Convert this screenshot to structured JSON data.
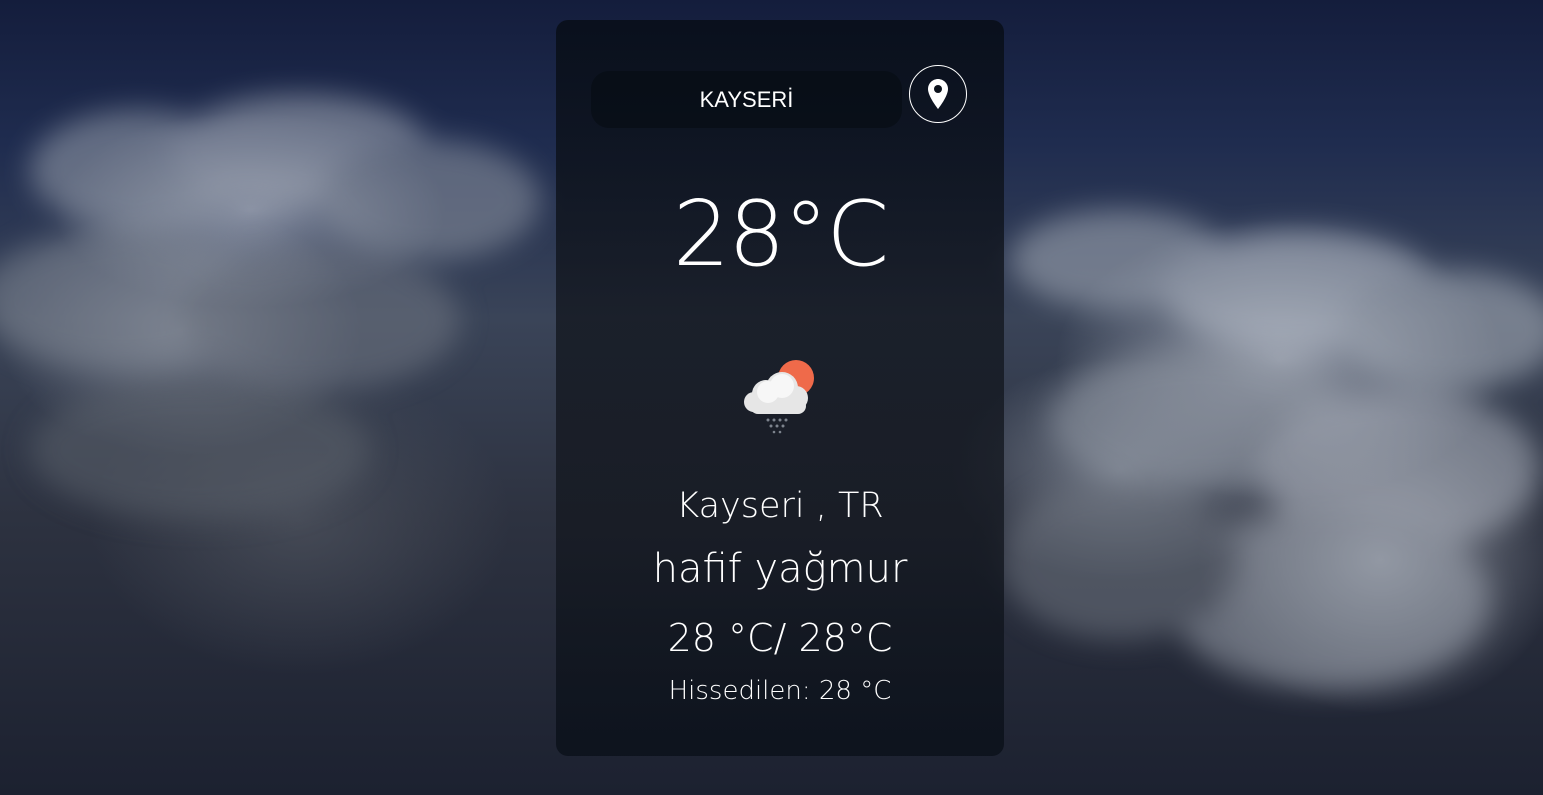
{
  "search": {
    "value": "KAYSERİ",
    "placeholder": ""
  },
  "location_button": {
    "icon": "map-pin-icon"
  },
  "weather": {
    "temperature": "28°C",
    "icon": "cloud-rain-sun-icon",
    "city": "Kayseri , TR",
    "description": "hafif yağmur",
    "min_max": "28 °C/ 28°C",
    "feels_like": "Hissedilen: 28 °C"
  },
  "colors": {
    "text": "#ffffff",
    "sun": "#ef6a4a",
    "cloud": "#f2f2f2",
    "card": "#0c121c"
  }
}
